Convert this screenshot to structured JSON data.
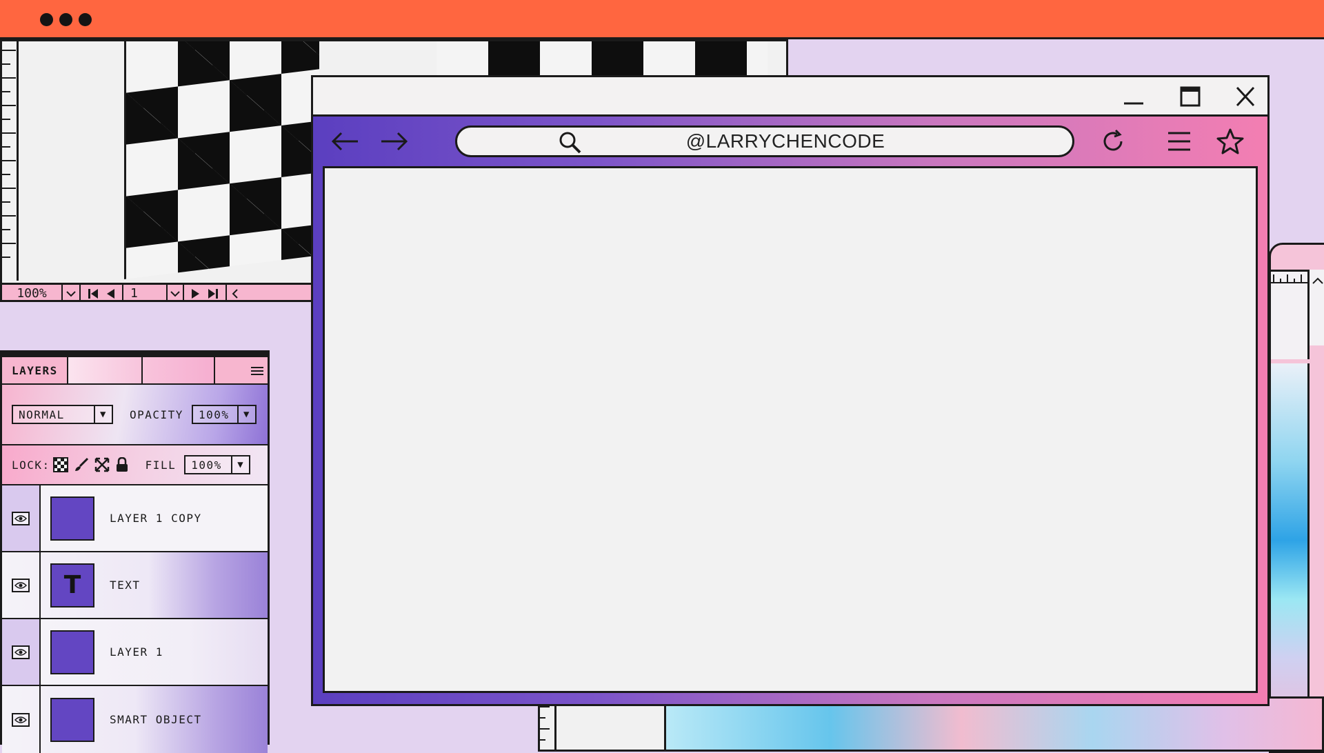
{
  "canvas_doc": {
    "zoom": "100%",
    "page": "1",
    "icons": [
      "chevron-down-icon",
      "first-page-icon",
      "prev-page-icon",
      "chevron-down-icon",
      "next-page-icon",
      "last-page-icon",
      "scroll-left-icon"
    ]
  },
  "layers_panel": {
    "tab_label": "LAYERS",
    "blend_mode": "NORMAL",
    "opacity_label": "OPACITY",
    "opacity_value": "100%",
    "lock_label": "LOCK:",
    "fill_label": "FILL",
    "fill_value": "100%",
    "layers": [
      {
        "name": "LAYER 1 COPY",
        "thumb": ""
      },
      {
        "name": "TEXT",
        "thumb": "T"
      },
      {
        "name": "LAYER 1",
        "thumb": ""
      },
      {
        "name": "SMART OBJECT",
        "thumb": ""
      }
    ]
  },
  "browser": {
    "address": "@LARRYCHENCODE",
    "toolbar_icons": [
      "back-arrow-icon",
      "forward-arrow-icon",
      "search-icon",
      "reload-icon",
      "menu-icon",
      "star-icon"
    ],
    "window_icons": [
      "minimize-icon",
      "maximize-icon",
      "close-icon"
    ]
  },
  "colors": {
    "topbar": "#ff6640",
    "background": "#e3d3f0",
    "accent_purple": "#6346c2",
    "accent_pink": "#f37eb2"
  }
}
